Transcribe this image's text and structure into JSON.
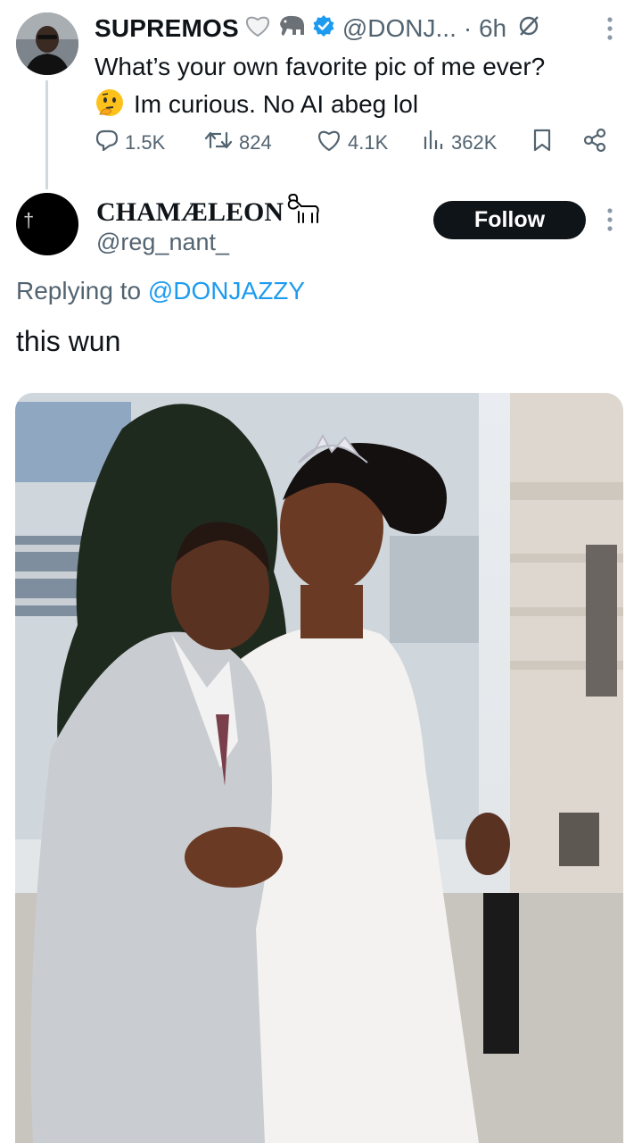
{
  "tweet": {
    "author": {
      "display_name": "SUPREMOS",
      "name_emojis": [
        "white-heart-icon",
        "elephant-icon"
      ],
      "verified": true,
      "handle": "@DONJ...",
      "time": "· 6h"
    },
    "text_line1": "What’s your own favorite pic of me ever?",
    "text_line2": "Im curious. No AI abeg lol",
    "stats": {
      "replies": "1.5K",
      "reposts": "824",
      "likes": "4.1K",
      "views": "362K"
    }
  },
  "reply": {
    "display_name": "CHAMÆLEON",
    "handle": "@reg_nant_",
    "avatar_glyph": "†",
    "follow_label": "Follow",
    "replying_prefix": "Replying to ",
    "replying_to": "@DONJAZZY",
    "text": "this wun"
  },
  "colors": {
    "accent": "#1d9bf0",
    "secondary_text": "#536471",
    "primary_text": "#0f1419",
    "thread_line": "#cfd9de"
  }
}
